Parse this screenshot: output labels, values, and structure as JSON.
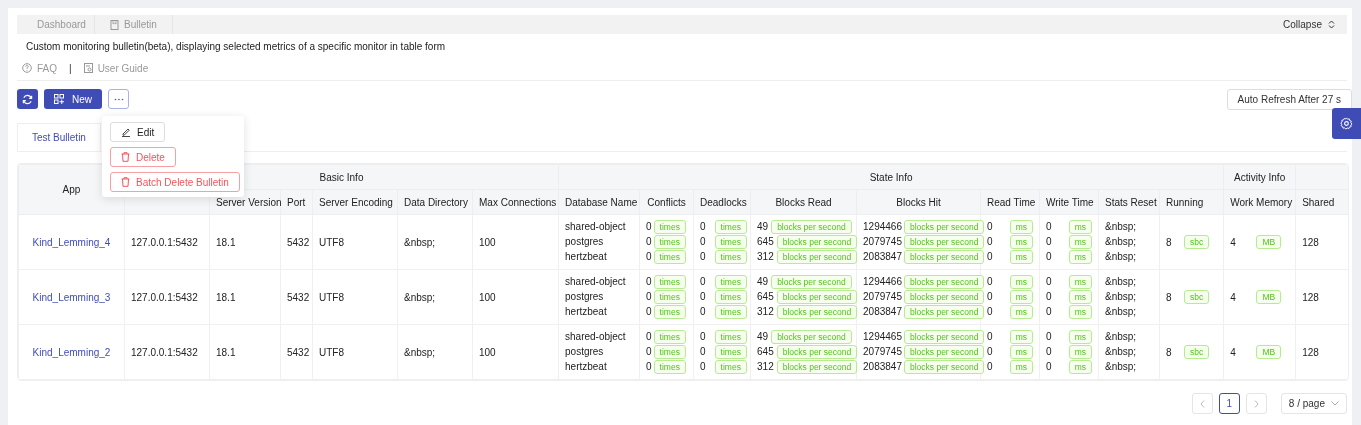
{
  "nav_tabs": [
    {
      "label": "Dashboard",
      "kind": "dashboard"
    },
    {
      "label": "Bulletin",
      "kind": "bulletin"
    }
  ],
  "collapse": {
    "label": "Collapse"
  },
  "description": "Custom monitoring bulletin(beta), displaying selected metrics of a specific monitor in table form",
  "links": [
    {
      "label": "FAQ",
      "kind": "faq"
    },
    {
      "label": "User Guide",
      "kind": "guide"
    }
  ],
  "link_separator": "|",
  "toolbar": {
    "new_label": "New",
    "auto_refresh": "Auto Refresh After 27 s"
  },
  "menu": [
    {
      "label": "Edit",
      "kind": "edit"
    },
    {
      "label": "Delete",
      "kind": "delete"
    },
    {
      "label": "Batch Delete Bulletin",
      "kind": "delete"
    }
  ],
  "bulletin_tabs": [
    {
      "label": "Test Bulletin",
      "selected": true
    }
  ],
  "table": {
    "groups": [
      "Basic Info",
      "State Info",
      "Activity Info"
    ],
    "app_column": "App",
    "columns": [
      "",
      "Server Version",
      "Port",
      "Server Encoding",
      "Data Directory",
      "Max Connections",
      "Database Name",
      "Conflicts",
      "Deadlocks",
      "Blocks Read",
      "Blocks Hit",
      "Read Time",
      "Write Time",
      "Stats Reset",
      "Running",
      "Work Memory",
      "Shared"
    ],
    "rows": [
      {
        "app": "Kind_Lemming_4",
        "host": "127.0.0.1:5432",
        "server_version": "18.1",
        "port": "5432",
        "encoding": "UTF8",
        "data_directory": "&nbsp;",
        "max_connections": "100",
        "databases": [
          {
            "name": "shared-object",
            "conflicts": {
              "value": "0",
              "unit": "times"
            },
            "deadlocks": {
              "value": "0",
              "unit": "times"
            },
            "blocks_read": {
              "value": "49",
              "unit": "blocks per second"
            },
            "blocks_hit": {
              "value": "1294466",
              "unit": "blocks per second"
            },
            "read_time": {
              "value": "0",
              "unit": "ms"
            },
            "write_time": {
              "value": "0",
              "unit": "ms"
            },
            "stats_reset": "&nbsp;"
          },
          {
            "name": "postgres",
            "conflicts": {
              "value": "0",
              "unit": "times"
            },
            "deadlocks": {
              "value": "0",
              "unit": "times"
            },
            "blocks_read": {
              "value": "645",
              "unit": "blocks per second"
            },
            "blocks_hit": {
              "value": "2079745",
              "unit": "blocks per second"
            },
            "read_time": {
              "value": "0",
              "unit": "ms"
            },
            "write_time": {
              "value": "0",
              "unit": "ms"
            },
            "stats_reset": "&nbsp;"
          },
          {
            "name": "hertzbeat",
            "conflicts": {
              "value": "0",
              "unit": "times"
            },
            "deadlocks": {
              "value": "0",
              "unit": "times"
            },
            "blocks_read": {
              "value": "312",
              "unit": "blocks per second"
            },
            "blocks_hit": {
              "value": "2083847",
              "unit": "blocks per second"
            },
            "read_time": {
              "value": "0",
              "unit": "ms"
            },
            "write_time": {
              "value": "0",
              "unit": "ms"
            },
            "stats_reset": "&nbsp;"
          }
        ],
        "running": {
          "value": "8",
          "unit": "sbc"
        },
        "work_memory": {
          "value": "4",
          "unit": "MB"
        },
        "shared": "128"
      },
      {
        "app": "Kind_Lemming_3",
        "host": "127.0.0.1:5432",
        "server_version": "18.1",
        "port": "5432",
        "encoding": "UTF8",
        "data_directory": "&nbsp;",
        "max_connections": "100",
        "databases": [
          {
            "name": "shared-object",
            "conflicts": {
              "value": "0",
              "unit": "times"
            },
            "deadlocks": {
              "value": "0",
              "unit": "times"
            },
            "blocks_read": {
              "value": "49",
              "unit": "blocks per second"
            },
            "blocks_hit": {
              "value": "1294466",
              "unit": "blocks per second"
            },
            "read_time": {
              "value": "0",
              "unit": "ms"
            },
            "write_time": {
              "value": "0",
              "unit": "ms"
            },
            "stats_reset": "&nbsp;"
          },
          {
            "name": "postgres",
            "conflicts": {
              "value": "0",
              "unit": "times"
            },
            "deadlocks": {
              "value": "0",
              "unit": "times"
            },
            "blocks_read": {
              "value": "645",
              "unit": "blocks per second"
            },
            "blocks_hit": {
              "value": "2079745",
              "unit": "blocks per second"
            },
            "read_time": {
              "value": "0",
              "unit": "ms"
            },
            "write_time": {
              "value": "0",
              "unit": "ms"
            },
            "stats_reset": "&nbsp;"
          },
          {
            "name": "hertzbeat",
            "conflicts": {
              "value": "0",
              "unit": "times"
            },
            "deadlocks": {
              "value": "0",
              "unit": "times"
            },
            "blocks_read": {
              "value": "312",
              "unit": "blocks per second"
            },
            "blocks_hit": {
              "value": "2083847",
              "unit": "blocks per second"
            },
            "read_time": {
              "value": "0",
              "unit": "ms"
            },
            "write_time": {
              "value": "0",
              "unit": "ms"
            },
            "stats_reset": "&nbsp;"
          }
        ],
        "running": {
          "value": "8",
          "unit": "sbc"
        },
        "work_memory": {
          "value": "4",
          "unit": "MB"
        },
        "shared": "128"
      },
      {
        "app": "Kind_Lemming_2",
        "host": "127.0.0.1:5432",
        "server_version": "18.1",
        "port": "5432",
        "encoding": "UTF8",
        "data_directory": "&nbsp;",
        "max_connections": "100",
        "databases": [
          {
            "name": "shared-object",
            "conflicts": {
              "value": "0",
              "unit": "times"
            },
            "deadlocks": {
              "value": "0",
              "unit": "times"
            },
            "blocks_read": {
              "value": "49",
              "unit": "blocks per second"
            },
            "blocks_hit": {
              "value": "1294465",
              "unit": "blocks per second"
            },
            "read_time": {
              "value": "0",
              "unit": "ms"
            },
            "write_time": {
              "value": "0",
              "unit": "ms"
            },
            "stats_reset": "&nbsp;"
          },
          {
            "name": "postgres",
            "conflicts": {
              "value": "0",
              "unit": "times"
            },
            "deadlocks": {
              "value": "0",
              "unit": "times"
            },
            "blocks_read": {
              "value": "645",
              "unit": "blocks per second"
            },
            "blocks_hit": {
              "value": "2079745",
              "unit": "blocks per second"
            },
            "read_time": {
              "value": "0",
              "unit": "ms"
            },
            "write_time": {
              "value": "0",
              "unit": "ms"
            },
            "stats_reset": "&nbsp;"
          },
          {
            "name": "hertzbeat",
            "conflicts": {
              "value": "0",
              "unit": "times"
            },
            "deadlocks": {
              "value": "0",
              "unit": "times"
            },
            "blocks_read": {
              "value": "312",
              "unit": "blocks per second"
            },
            "blocks_hit": {
              "value": "2083847",
              "unit": "blocks per second"
            },
            "read_time": {
              "value": "0",
              "unit": "ms"
            },
            "write_time": {
              "value": "0",
              "unit": "ms"
            },
            "stats_reset": "&nbsp;"
          }
        ],
        "running": {
          "value": "8",
          "unit": "sbc"
        },
        "work_memory": {
          "value": "4",
          "unit": "MB"
        },
        "shared": "128"
      }
    ]
  },
  "pagination": {
    "pages": [
      {
        "label": "1",
        "selected": true
      }
    ],
    "page_size": "8 / page"
  }
}
